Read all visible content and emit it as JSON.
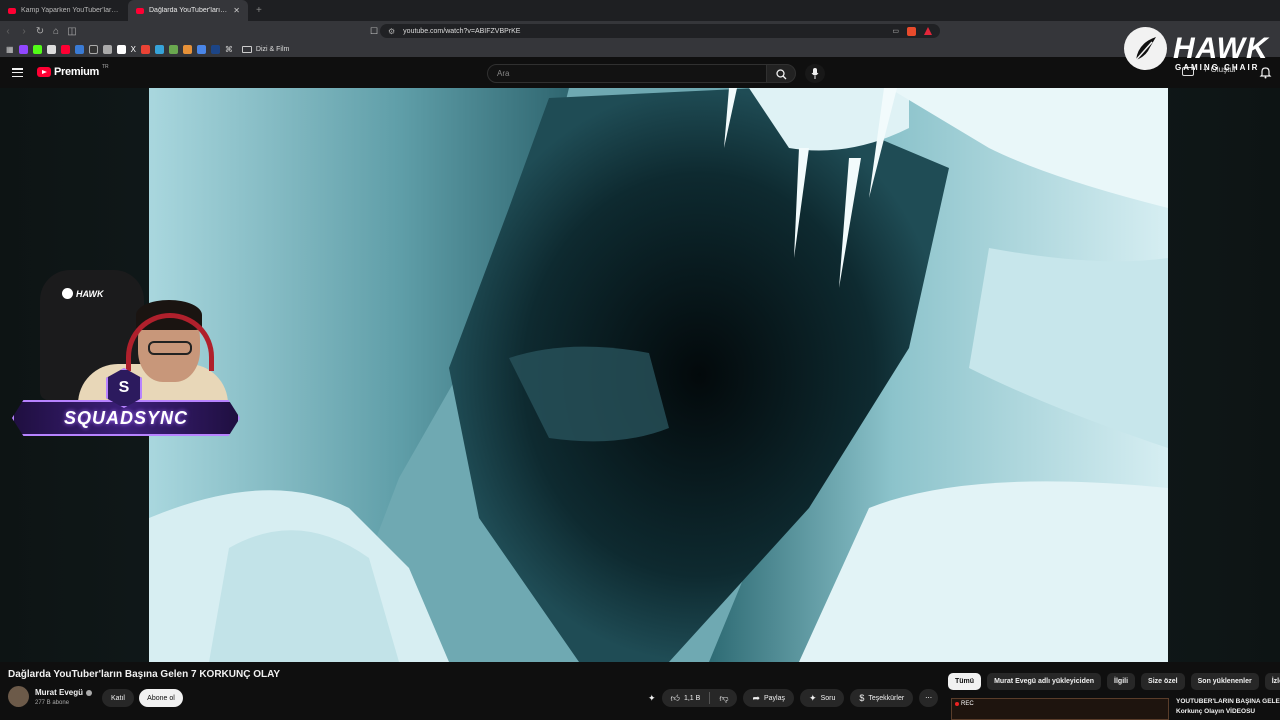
{
  "browser": {
    "tabs": [
      {
        "title": "Kamp Yaparken YouTuber'ların Başına",
        "active": false
      },
      {
        "title": "Dağlarda YouTuber'ların Başına",
        "active": true
      }
    ],
    "url": "youtube.com/watch?v=ABIFZVBPrKE",
    "bookmark_folder": "Dizi & Film"
  },
  "youtube": {
    "logo_text": "Premium",
    "logo_country": "TR",
    "search_placeholder": "Ara",
    "create_label": "Oluştur"
  },
  "overlay": {
    "brand": "HAWK",
    "brand_sub": "GAMING CHAIR",
    "chair_logo": "HAWK",
    "banner": "SQUADSYNC",
    "badge": "S"
  },
  "video": {
    "title": "Dağlarda YouTuber'ların Başına Gelen 7 KORKUNÇ OLAY",
    "channel": "Murat Evegü",
    "subscribers": "277 B abone",
    "join_label": "Katıl",
    "subscribe_label": "Abone ol",
    "likes": "1,1 B",
    "share_label": "Paylaş",
    "ask_label": "Soru",
    "thanks_label": "Teşekkürler",
    "more_label": "⋯"
  },
  "sidebar": {
    "chips": [
      "Tümü",
      "Murat Evegü adlı yükleyiciden",
      "İlgili",
      "Size özel",
      "Son yüklenenler",
      "İzlenenler"
    ],
    "rec_badge": "REC",
    "rec_title_line1": "YOUTUBER'LARIN BAŞINA GELEN",
    "rec_title_line2": "Korkunç Olayın VİDEOSU"
  },
  "colors": {
    "background": "#0f0f0f",
    "youtube_red": "#ff0033",
    "ice": "#7fb9c2",
    "squad_purple": "#b783ff"
  }
}
